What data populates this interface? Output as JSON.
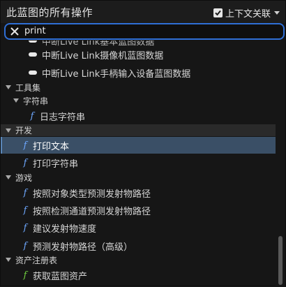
{
  "header": {
    "title": "此蓝图的所有操作",
    "context_label": "上下文关联",
    "context_checked": true
  },
  "search": {
    "value": "print"
  },
  "list": {
    "cut_item": "中断Live Link基本蓝图数据",
    "items": [
      {
        "label": "中断Live Link摄像机蓝图数据",
        "icon": "pill-icon"
      },
      {
        "label": "中断Live Link手柄输入设备蓝图数据",
        "icon": "pill-icon"
      }
    ],
    "categories": [
      {
        "label": "工具集"
      },
      {
        "label": "字符串"
      },
      {
        "label": "开发"
      },
      {
        "label": "游戏"
      },
      {
        "label": "资产注册表"
      }
    ],
    "functions": [
      {
        "label": "日志字符串"
      },
      {
        "label": "打印文本",
        "selected": true
      },
      {
        "label": "打印字符串"
      },
      {
        "label": "按照对象类型预测发射物路径"
      },
      {
        "label": "按照检测通道预测发射物路径"
      },
      {
        "label": "建议发射物速度"
      },
      {
        "label": "预测发射物路径（高级）"
      },
      {
        "label": "获取蓝图资产"
      }
    ]
  },
  "colors": {
    "accent": "#2f6fd6",
    "selected_row": "#3a4f66",
    "function_icon": "#6ea8ff",
    "asset_function_icon": "#70d040"
  },
  "scrollbar": {
    "position_fraction": 0.95
  }
}
